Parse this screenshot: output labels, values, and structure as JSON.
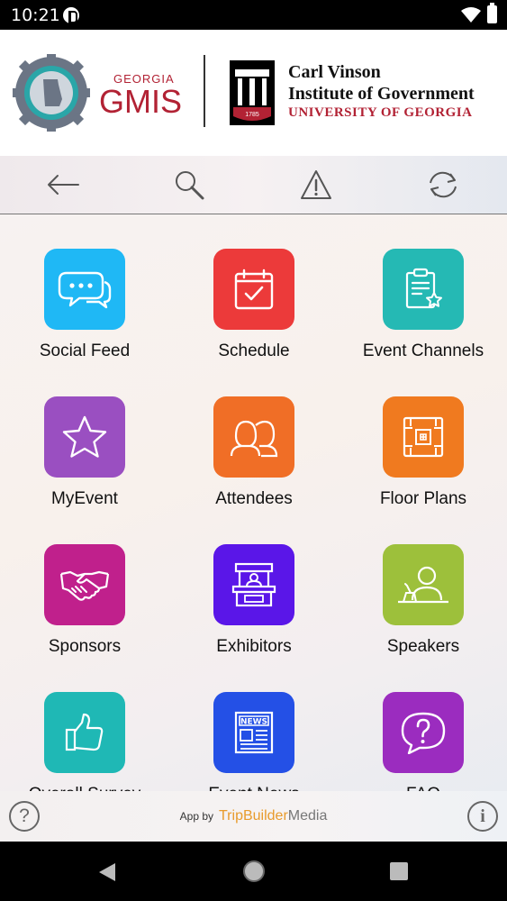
{
  "status_bar": {
    "time": "10:21"
  },
  "banner": {
    "gmis_small": "GEORGIA",
    "gmis": "GMIS",
    "org_line1": "Carl Vinson",
    "org_line2": "Institute of Government",
    "org_line3": "UNIVERSITY OF GEORGIA",
    "seal_year": "1785"
  },
  "toolbar": {
    "back_icon": "arrow-left-icon",
    "search_icon": "search-icon",
    "alert_icon": "warning-icon",
    "sync_icon": "sync-icon"
  },
  "tiles": [
    {
      "label": "Social Feed",
      "color": "#1fb8f5",
      "icon": "chat-bubbles-icon"
    },
    {
      "label": "Schedule",
      "color": "#ec3a3a",
      "icon": "calendar-check-icon"
    },
    {
      "label": "Event Channels",
      "color": "#25b9b4",
      "icon": "clipboard-star-icon"
    },
    {
      "label": "MyEvent",
      "color": "#9a4fc1",
      "icon": "star-icon"
    },
    {
      "label": "Attendees",
      "color": "#f06e26",
      "icon": "people-icon"
    },
    {
      "label": "Floor Plans",
      "color": "#f07a1f",
      "icon": "floor-plan-icon"
    },
    {
      "label": "Sponsors",
      "color": "#c0208c",
      "icon": "handshake-icon"
    },
    {
      "label": "Exhibitors",
      "color": "#5a16e8",
      "icon": "booth-icon"
    },
    {
      "label": "Speakers",
      "color": "#9dc03b",
      "icon": "speaker-podium-icon"
    },
    {
      "label": "Overall Survey",
      "color": "#1fb8b5",
      "icon": "thumbs-up-icon"
    },
    {
      "label": "Event News",
      "color": "#2450e6",
      "icon": "newspaper-icon"
    },
    {
      "label": "FAQ",
      "color": "#9b2cbf",
      "icon": "question-bubble-icon"
    }
  ],
  "footer": {
    "app_by": "App by",
    "brand_part1": "TripBuilder",
    "brand_part2": "Media",
    "help_glyph": "?",
    "info_glyph": "i"
  }
}
